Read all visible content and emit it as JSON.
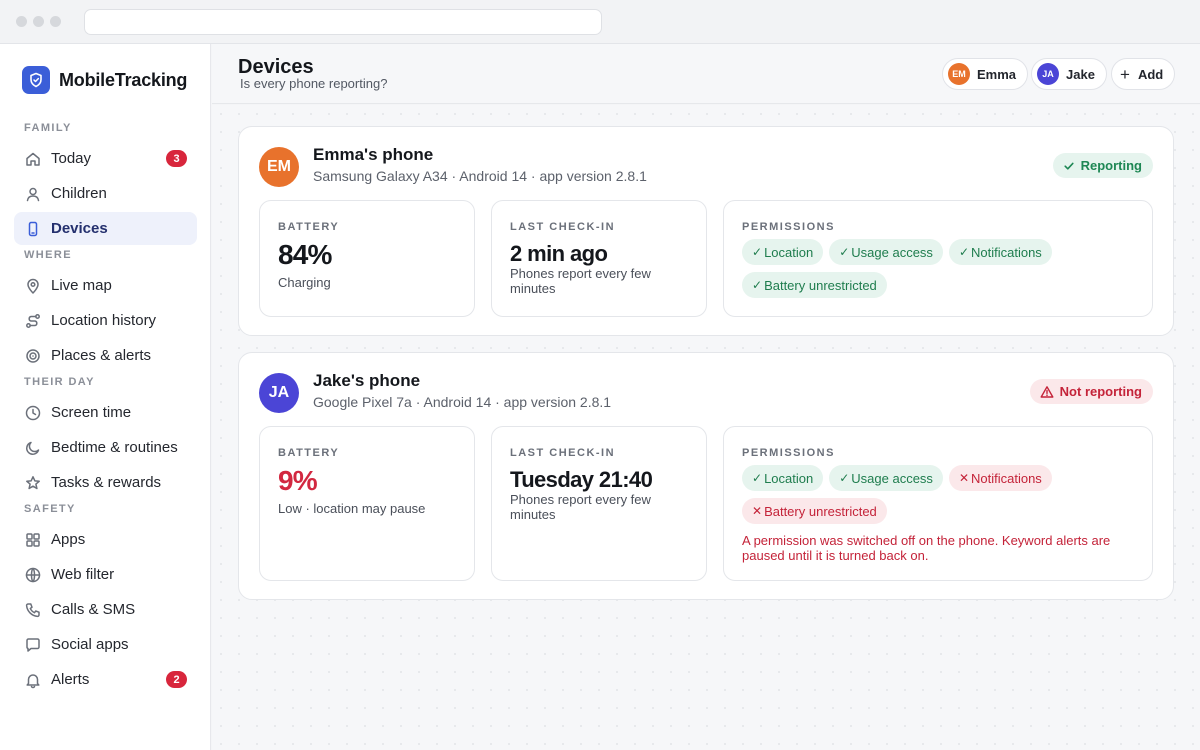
{
  "app": {
    "name": "MobileTracking",
    "accent": "#3b5ed8"
  },
  "sidebar": {
    "sections": [
      {
        "title": "FAMILY",
        "items": [
          {
            "label": "Today",
            "icon": "home-icon",
            "badge": "3"
          },
          {
            "label": "Children",
            "icon": "user-icon"
          },
          {
            "label": "Devices",
            "icon": "phone-icon",
            "active": true
          }
        ]
      },
      {
        "title": "WHERE",
        "items": [
          {
            "label": "Live map",
            "icon": "map-pin-icon"
          },
          {
            "label": "Location history",
            "icon": "route-icon"
          },
          {
            "label": "Places & alerts",
            "icon": "target-icon"
          }
        ]
      },
      {
        "title": "THEIR DAY",
        "items": [
          {
            "label": "Screen time",
            "icon": "clock-icon"
          },
          {
            "label": "Bedtime & routines",
            "icon": "moon-icon"
          },
          {
            "label": "Tasks & rewards",
            "icon": "star-icon"
          }
        ]
      },
      {
        "title": "SAFETY",
        "items": [
          {
            "label": "Apps",
            "icon": "grid-icon"
          },
          {
            "label": "Web filter",
            "icon": "globe-icon"
          },
          {
            "label": "Calls & SMS",
            "icon": "phone-call-icon"
          },
          {
            "label": "Social apps",
            "icon": "chat-icon"
          },
          {
            "label": "Alerts",
            "icon": "bell-icon",
            "badge": "2"
          }
        ]
      }
    ]
  },
  "header": {
    "title": "Devices",
    "subtitle": "Is every phone reporting?",
    "profiles": [
      {
        "initials": "EM",
        "name": "Emma",
        "color": "#e8722c"
      },
      {
        "initials": "JA",
        "name": "Jake",
        "color": "#4b45d6"
      }
    ],
    "add_label": "Add"
  },
  "devices": [
    {
      "initials": "EM",
      "avatar_color": "#e8722c",
      "name": "Emma's phone",
      "meta": "Samsung Galaxy A34 · Android 14 · app version 2.8.1",
      "status": {
        "label": "Reporting",
        "ok": true
      },
      "battery": {
        "label": "BATTERY",
        "value": "84%",
        "sub": "Charging",
        "low": false
      },
      "checkin": {
        "label": "LAST CHECK-IN",
        "value": "2 min ago",
        "sub": "Phones report every few minutes"
      },
      "permissions": {
        "label": "PERMISSIONS",
        "items": [
          {
            "label": "Location",
            "ok": true
          },
          {
            "label": "Usage access",
            "ok": true
          },
          {
            "label": "Notifications",
            "ok": true
          },
          {
            "label": "Battery unrestricted",
            "ok": true
          }
        ],
        "warning": ""
      }
    },
    {
      "initials": "JA",
      "avatar_color": "#4b45d6",
      "name": "Jake's phone",
      "meta": "Google Pixel 7a · Android 14 · app version 2.8.1",
      "status": {
        "label": "Not reporting",
        "ok": false
      },
      "battery": {
        "label": "BATTERY",
        "value": "9%",
        "sub": "Low · location may pause",
        "low": true
      },
      "checkin": {
        "label": "LAST CHECK-IN",
        "value": "Tuesday 21:40",
        "sub": "Phones report every few minutes"
      },
      "permissions": {
        "label": "PERMISSIONS",
        "items": [
          {
            "label": "Location",
            "ok": true
          },
          {
            "label": "Usage access",
            "ok": true
          },
          {
            "label": "Notifications",
            "ok": false
          },
          {
            "label": "Battery unrestricted",
            "ok": false
          }
        ],
        "warning": "A permission was switched off on the phone. Keyword alerts are paused until it is turned back on."
      }
    }
  ]
}
